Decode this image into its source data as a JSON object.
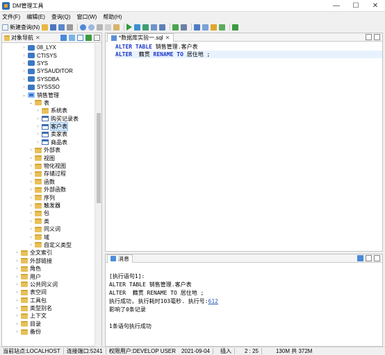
{
  "window": {
    "title": "DM管理工具",
    "minimize": "—",
    "maximize": "☐",
    "close": "✕"
  },
  "menu": [
    "文件(F)",
    "编辑(E)",
    "查询(Q)",
    "窗口(W)",
    "帮助(H)"
  ],
  "toolbar": {
    "new_query": "新建查询(N)"
  },
  "nav": {
    "tab_label": "对象导航",
    "tree": [
      {
        "label": "08_LYX",
        "depth": 1,
        "icon": "db",
        "twisty": "›"
      },
      {
        "label": "CTISYS",
        "depth": 1,
        "icon": "db",
        "twisty": "›"
      },
      {
        "label": "SYS",
        "depth": 1,
        "icon": "db",
        "twisty": "›"
      },
      {
        "label": "SYSAUDITOR",
        "depth": 1,
        "icon": "db",
        "twisty": "›"
      },
      {
        "label": "SYSDBA",
        "depth": 1,
        "icon": "db",
        "twisty": "›"
      },
      {
        "label": "SYSSSO",
        "depth": 1,
        "icon": "db",
        "twisty": "›"
      },
      {
        "label": "销售管理",
        "depth": 1,
        "icon": "db-active",
        "twisty": "⌄"
      },
      {
        "label": "表",
        "depth": 2,
        "icon": "folder",
        "twisty": "⌄"
      },
      {
        "label": "系统表",
        "depth": 3,
        "icon": "folder",
        "twisty": "›"
      },
      {
        "label": "购买记录表",
        "depth": 3,
        "icon": "table",
        "twisty": "›"
      },
      {
        "label": "客户表",
        "depth": 3,
        "icon": "table",
        "twisty": "›",
        "selected": true
      },
      {
        "label": "卖家表",
        "depth": 3,
        "icon": "table",
        "twisty": "›"
      },
      {
        "label": "商品表",
        "depth": 3,
        "icon": "table",
        "twisty": "›"
      },
      {
        "label": "外部表",
        "depth": 2,
        "icon": "folder",
        "twisty": "›"
      },
      {
        "label": "视图",
        "depth": 2,
        "icon": "folder",
        "twisty": "›"
      },
      {
        "label": "物化视图",
        "depth": 2,
        "icon": "folder",
        "twisty": "›"
      },
      {
        "label": "存储过程",
        "depth": 2,
        "icon": "folder",
        "twisty": "›"
      },
      {
        "label": "函数",
        "depth": 2,
        "icon": "folder",
        "twisty": "›"
      },
      {
        "label": "外部函数",
        "depth": 2,
        "icon": "folder",
        "twisty": "›"
      },
      {
        "label": "序列",
        "depth": 2,
        "icon": "folder",
        "twisty": "›"
      },
      {
        "label": "触发器",
        "depth": 2,
        "icon": "folder",
        "twisty": "›"
      },
      {
        "label": "包",
        "depth": 2,
        "icon": "folder",
        "twisty": "›"
      },
      {
        "label": "类",
        "depth": 2,
        "icon": "folder",
        "twisty": "›"
      },
      {
        "label": "同义词",
        "depth": 2,
        "icon": "folder",
        "twisty": "›"
      },
      {
        "label": "域",
        "depth": 2,
        "icon": "folder",
        "twisty": "›"
      },
      {
        "label": "自定义类型",
        "depth": 2,
        "icon": "folder",
        "twisty": "›"
      },
      {
        "label": "全文索引",
        "depth": 0,
        "icon": "folder",
        "twisty": "›"
      },
      {
        "label": "外部链接",
        "depth": 0,
        "icon": "folder",
        "twisty": "›"
      },
      {
        "label": "角色",
        "depth": 0,
        "icon": "folder",
        "twisty": "›"
      },
      {
        "label": "用户",
        "depth": 0,
        "icon": "folder",
        "twisty": "›"
      },
      {
        "label": "公共同义词",
        "depth": 0,
        "icon": "folder",
        "twisty": "›"
      },
      {
        "label": "表空间",
        "depth": 0,
        "icon": "folder",
        "twisty": "›"
      },
      {
        "label": "工具包",
        "depth": 0,
        "icon": "folder",
        "twisty": "›"
      },
      {
        "label": "类型别名",
        "depth": 0,
        "icon": "folder",
        "twisty": "›"
      },
      {
        "label": "上下文",
        "depth": 0,
        "icon": "folder",
        "twisty": "›"
      },
      {
        "label": "目录",
        "depth": 0,
        "icon": "folder",
        "twisty": "›"
      },
      {
        "label": "备份",
        "depth": 0,
        "icon": "folder",
        "twisty": "›"
      }
    ]
  },
  "editor": {
    "tab_label": "*数据库实验一.sql",
    "close": "✕",
    "lines": [
      {
        "kw1": "ALTER TABLE",
        "text": " 销售管理.客户表"
      },
      {
        "kw1": "ALTER",
        "text": "  籍贯 ",
        "kw2": "RENAME TO",
        "text2": " 居住地 ;"
      }
    ]
  },
  "messages": {
    "tab_label": "消息",
    "lines": [
      "[执行语句1]:",
      "ALTER TABLE 销售管理.客户表",
      "ALTER  籍贯 RENAME TO 居住地 ;",
      "",
      "影响了0条记录",
      "",
      "1条语句执行成功"
    ],
    "exec_prefix": "执行成功, 执行耗时103毫秒. 执行号:",
    "exec_number": "612"
  },
  "status": {
    "site": "当前站点:LOCALHOST",
    "port": "连接端口:5241",
    "access": "权限用户:DEVELOP USER",
    "date": "2021-09-04",
    "mode": "插入",
    "position": "2 : 25",
    "memory": "130M 共 372M"
  }
}
